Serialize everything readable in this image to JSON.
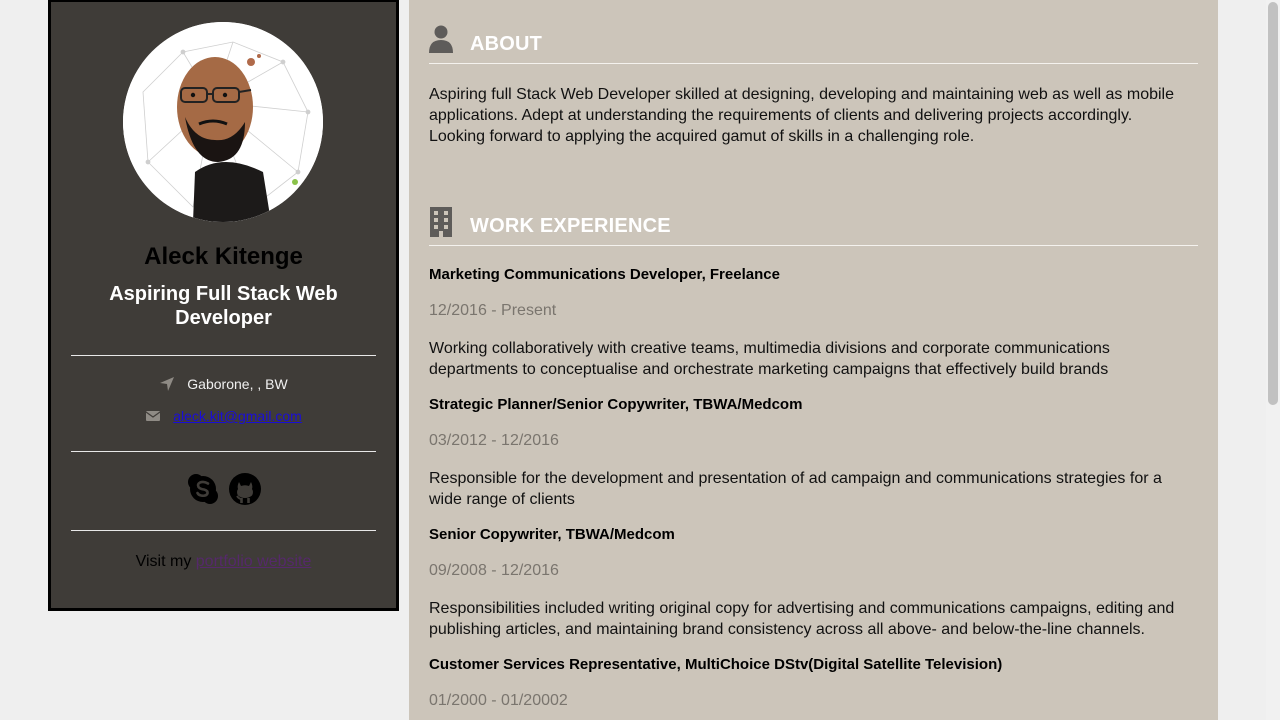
{
  "profile": {
    "name": "Aleck Kitenge",
    "title": "Aspiring Full Stack Web Developer",
    "location": "Gaborone, , BW",
    "email": "aleck.kit@gmail.com",
    "visit_prefix": "Visit my ",
    "visit_link": "portfolio website",
    "icons": {
      "location": "location-arrow-icon",
      "email": "envelope-icon",
      "skype": "skype-icon",
      "github": "github-icon"
    }
  },
  "about": {
    "heading": "ABOUT",
    "icon": "user-icon",
    "text": "Aspiring full Stack Web Developer skilled at designing, developing and maintaining web as well as mobile applications. Adept at understanding the requirements of clients and delivering projects accordingly. Looking forward to applying the acquired gamut of skills in a challenging role."
  },
  "work": {
    "heading": "WORK EXPERIENCE",
    "icon": "building-icon",
    "jobs": [
      {
        "title": "Marketing Communications Developer, Freelance",
        "dates": "12/2016 - Present",
        "desc": "Working collaboratively with creative teams, multimedia divisions and corporate communications departments to conceptualise and orchestrate marketing campaigns that effectively build brands"
      },
      {
        "title": "Strategic Planner/Senior Copywriter, TBWA/Medcom",
        "dates": "03/2012 - 12/2016",
        "desc": "Responsible for the development and presentation of ad campaign and communications strategies for a wide range of clients"
      },
      {
        "title": "Senior Copywriter, TBWA/Medcom",
        "dates": "09/2008 - 12/2016",
        "desc": "Responsibilities included writing original copy for advertising and communications campaigns, editing and publishing articles, and maintaining brand consistency across all above- and below-the-line channels."
      },
      {
        "title": "Customer Services Representative, MultiChoice DStv(Digital Satellite Television)",
        "dates": "01/2000 - 01/20002"
      }
    ]
  },
  "colors": {
    "page_bg": "#efefef",
    "card_bg": "#3f3c38",
    "panel_bg": "#ccc5ba",
    "heading": "#ffffff",
    "date_text": "#7a756e",
    "email_link": "#1a0dd8",
    "visited_link": "#55296a"
  }
}
